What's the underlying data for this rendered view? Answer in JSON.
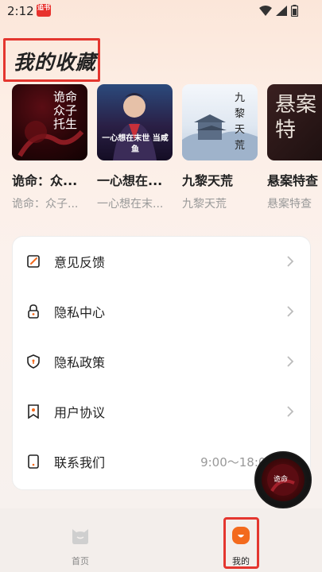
{
  "status_bar": {
    "time": "2:12",
    "app_icon_text": "追书"
  },
  "page": {
    "title": "我的收藏"
  },
  "favorites": [
    {
      "title": "诡命：众...",
      "subtitle": "诡命：众子...",
      "cover_text": "诡命 众子托生"
    },
    {
      "title": "一心想在...",
      "subtitle": "一心想在末...",
      "cover_text": "一心想在末世 当咸鱼"
    },
    {
      "title": "九黎天荒",
      "subtitle": "九黎天荒",
      "cover_text": "九黎天荒"
    },
    {
      "title": "悬案特查",
      "subtitle": "悬案特查",
      "cover_text": "悬案特"
    }
  ],
  "menu": [
    {
      "label": "意见反馈",
      "icon": "edit-icon",
      "arrow": true
    },
    {
      "label": "隐私中心",
      "icon": "lock-icon",
      "arrow": true
    },
    {
      "label": "隐私政策",
      "icon": "shield-icon",
      "arrow": true
    },
    {
      "label": "用户协议",
      "icon": "bookmark-icon",
      "arrow": true
    },
    {
      "label": "联系我们",
      "icon": "phone-icon",
      "extra": "9:00～18:00",
      "arrow": false
    }
  ],
  "tabbar": {
    "tabs": [
      {
        "label": "首页",
        "icon": "home-cat-icon",
        "active": false
      },
      {
        "label": "我的",
        "icon": "profile-icon",
        "active": true
      }
    ]
  },
  "colors": {
    "accent": "#f36a1d",
    "highlight_border": "#e4362f"
  }
}
